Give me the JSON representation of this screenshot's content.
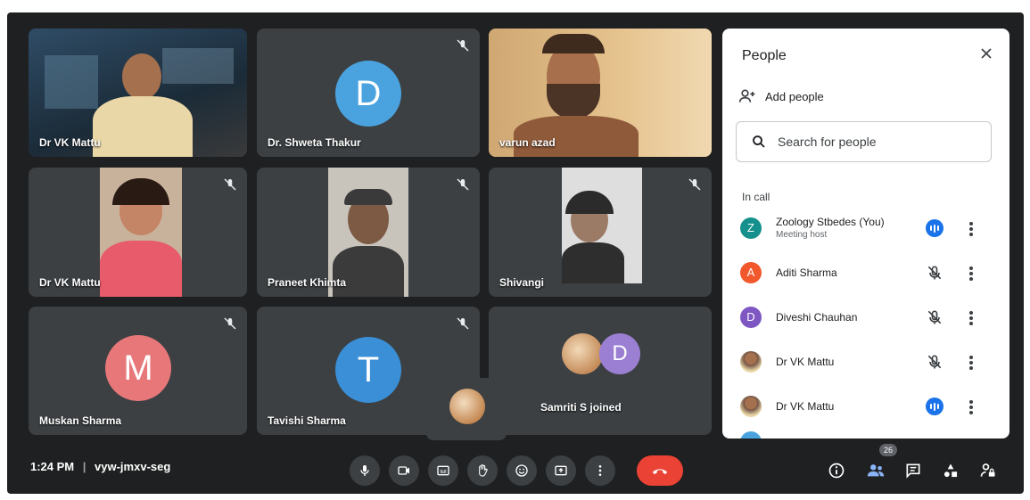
{
  "tiles": [
    {
      "name": "Dr VK Mattu",
      "kind": "video"
    },
    {
      "name": "Dr. Shweta Thakur",
      "kind": "avatar",
      "letter": "D",
      "color": "#4aa3df"
    },
    {
      "name": "varun azad",
      "kind": "video"
    },
    {
      "name": "Dr VK Mattu",
      "kind": "video"
    },
    {
      "name": "Praneet Khimta",
      "kind": "video"
    },
    {
      "name": "Shivangi",
      "kind": "video"
    },
    {
      "name": "Muskan Sharma",
      "kind": "avatar",
      "letter": "M",
      "color": "#e8777a"
    },
    {
      "name": "Tavishi Sharma",
      "kind": "avatar",
      "letter": "T",
      "color": "#3b8fd6"
    },
    {
      "name": "Samriti S joined",
      "kind": "join",
      "letter": "D",
      "color": "#9b7fd3"
    }
  ],
  "panel": {
    "title": "People",
    "add_people": "Add people",
    "search_placeholder": "Search for people",
    "section_label": "In call",
    "participants": [
      {
        "name": "Zoology Stbedes (You)",
        "subtitle": "Meeting host",
        "letter": "Z",
        "color": "#15908c",
        "state": "speaking"
      },
      {
        "name": "Aditi Sharma",
        "letter": "A",
        "color": "#f1582c",
        "state": "muted"
      },
      {
        "name": "Diveshi Chauhan",
        "letter": "D",
        "color": "#7e57c2",
        "state": "muted"
      },
      {
        "name": "Dr VK Mattu",
        "letter": "",
        "color": "#6d4c41",
        "state": "muted"
      },
      {
        "name": "Dr VK Mattu",
        "letter": "",
        "color": "#6d4c41",
        "state": "speaking"
      }
    ]
  },
  "bottom_bar": {
    "time": "1:24 PM",
    "meeting_code": "vyw-jmxv-seg",
    "participant_count": "26"
  },
  "colors": {
    "background": "#1f2021",
    "tile": "#3c4043",
    "end_call": "#ea4335",
    "speaking": "#1a73e8"
  }
}
